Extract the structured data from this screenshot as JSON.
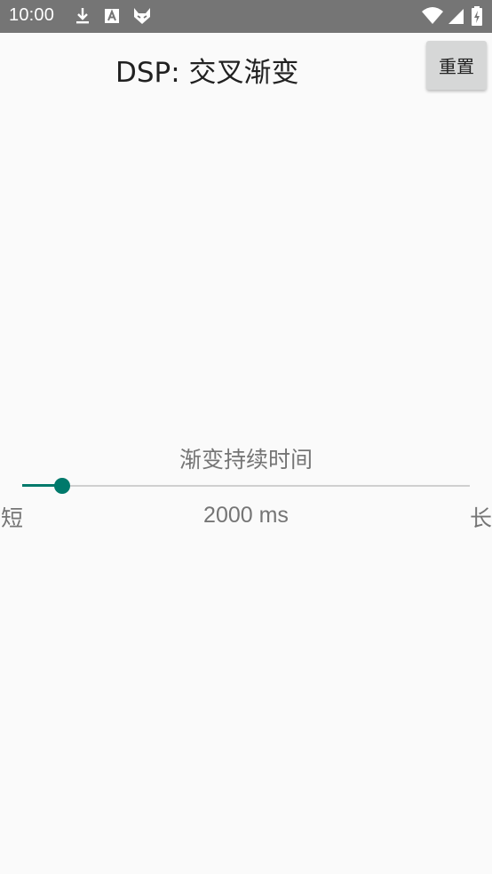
{
  "status_bar": {
    "time": "10:00",
    "icons": [
      "download-icon",
      "a-icon",
      "fox-icon",
      "wifi-icon",
      "signal-icon",
      "battery-charging-icon"
    ]
  },
  "header": {
    "title": "DSP: 交叉渐变",
    "reset_label": "重置"
  },
  "slider": {
    "label": "渐变持续时间",
    "min_label": "短",
    "max_label": "长",
    "value_text": "2000 ms",
    "position_fraction": 0.09,
    "accent_color": "#00796b",
    "track_color": "#cfcfcf"
  }
}
